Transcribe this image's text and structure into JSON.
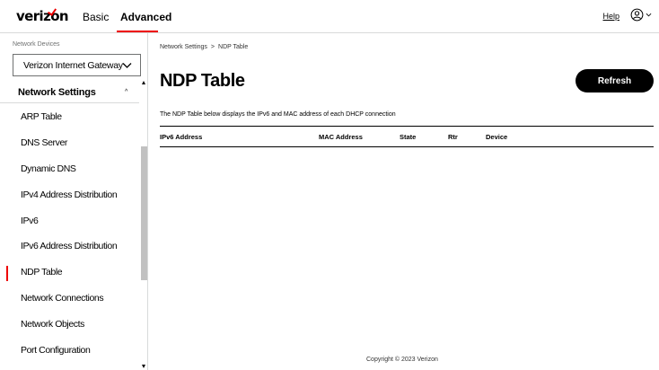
{
  "header": {
    "logo_text": "verizon",
    "tabs": [
      {
        "label": "Basic"
      },
      {
        "label": "Advanced"
      }
    ],
    "help_label": "Help",
    "accent_color": "#ee0000"
  },
  "sidebar": {
    "devices_label": "Network Devices",
    "device_select_value": "Verizon Internet Gateway",
    "section_title": "Network Settings",
    "items": [
      {
        "label": "ARP Table"
      },
      {
        "label": "DNS Server"
      },
      {
        "label": "Dynamic DNS"
      },
      {
        "label": "IPv4 Address Distribution"
      },
      {
        "label": "IPv6"
      },
      {
        "label": "IPv6 Address Distribution"
      },
      {
        "label": "NDP Table"
      },
      {
        "label": "Network Connections"
      },
      {
        "label": "Network Objects"
      },
      {
        "label": "Port Configuration"
      }
    ],
    "active_item": "NDP Table"
  },
  "main": {
    "breadcrumb": {
      "parent": "Network Settings",
      "separator": ">",
      "current": "NDP Table"
    },
    "title": "NDP Table",
    "refresh_label": "Refresh",
    "description": "The NDP Table below displays the IPv6 and MAC address of each DHCP connection",
    "table": {
      "columns": [
        "IPv6 Address",
        "MAC Address",
        "State",
        "Rtr",
        "Device"
      ],
      "rows": []
    },
    "footer": "Copyright © 2023 Verizon"
  },
  "icons": {
    "account": "account-circle-icon",
    "chevron": "chevron-down-icon",
    "caret_up": "caret-up-icon"
  }
}
